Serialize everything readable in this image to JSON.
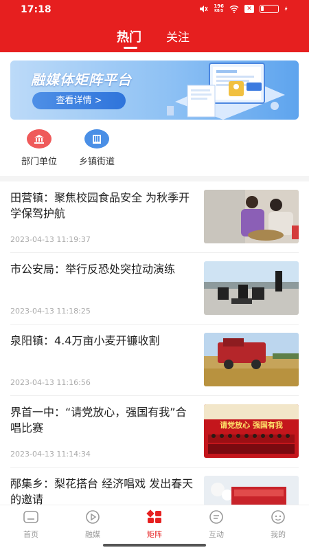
{
  "status_bar": {
    "time": "17:18",
    "net_speed_value": "196",
    "net_speed_unit": "KB/S"
  },
  "top_tabs": {
    "hot": "热门",
    "follow": "关注"
  },
  "banner": {
    "title": "融媒体矩阵平台",
    "button": "查看详情 >"
  },
  "quick_entries": [
    {
      "label": "部门单位",
      "color": "#ef5a5a"
    },
    {
      "label": "乡镇街道",
      "color": "#4a8fe6"
    }
  ],
  "news": [
    {
      "title": "田营镇：聚焦校园食品安全 为秋季开学保驾护航",
      "time": "2023-04-13 11:19:37"
    },
    {
      "title": "市公安局：举行反恐处突拉动演练",
      "time": "2023-04-13 11:18:25"
    },
    {
      "title": "泉阳镇：4.4万亩小麦开镰收割",
      "time": "2023-04-13 11:16:56"
    },
    {
      "title": "界首一中：“请党放心，强国有我”合唱比赛",
      "time": "2023-04-13 11:14:34"
    },
    {
      "title": "邴集乡：梨花搭台 经济唱戏 发出春天的邀请",
      "time": ""
    }
  ],
  "thumb_texts": {
    "chorus_banner": "请党放心 强国有我"
  },
  "bottom_nav": [
    {
      "label": "首页",
      "icon": "home-icon"
    },
    {
      "label": "融媒",
      "icon": "play-icon"
    },
    {
      "label": "矩阵",
      "icon": "matrix-icon",
      "active": true
    },
    {
      "label": "互动",
      "icon": "chat-icon"
    },
    {
      "label": "我的",
      "icon": "profile-icon"
    }
  ],
  "colors": {
    "brand_red": "#e61f1f",
    "muted": "#999999"
  }
}
